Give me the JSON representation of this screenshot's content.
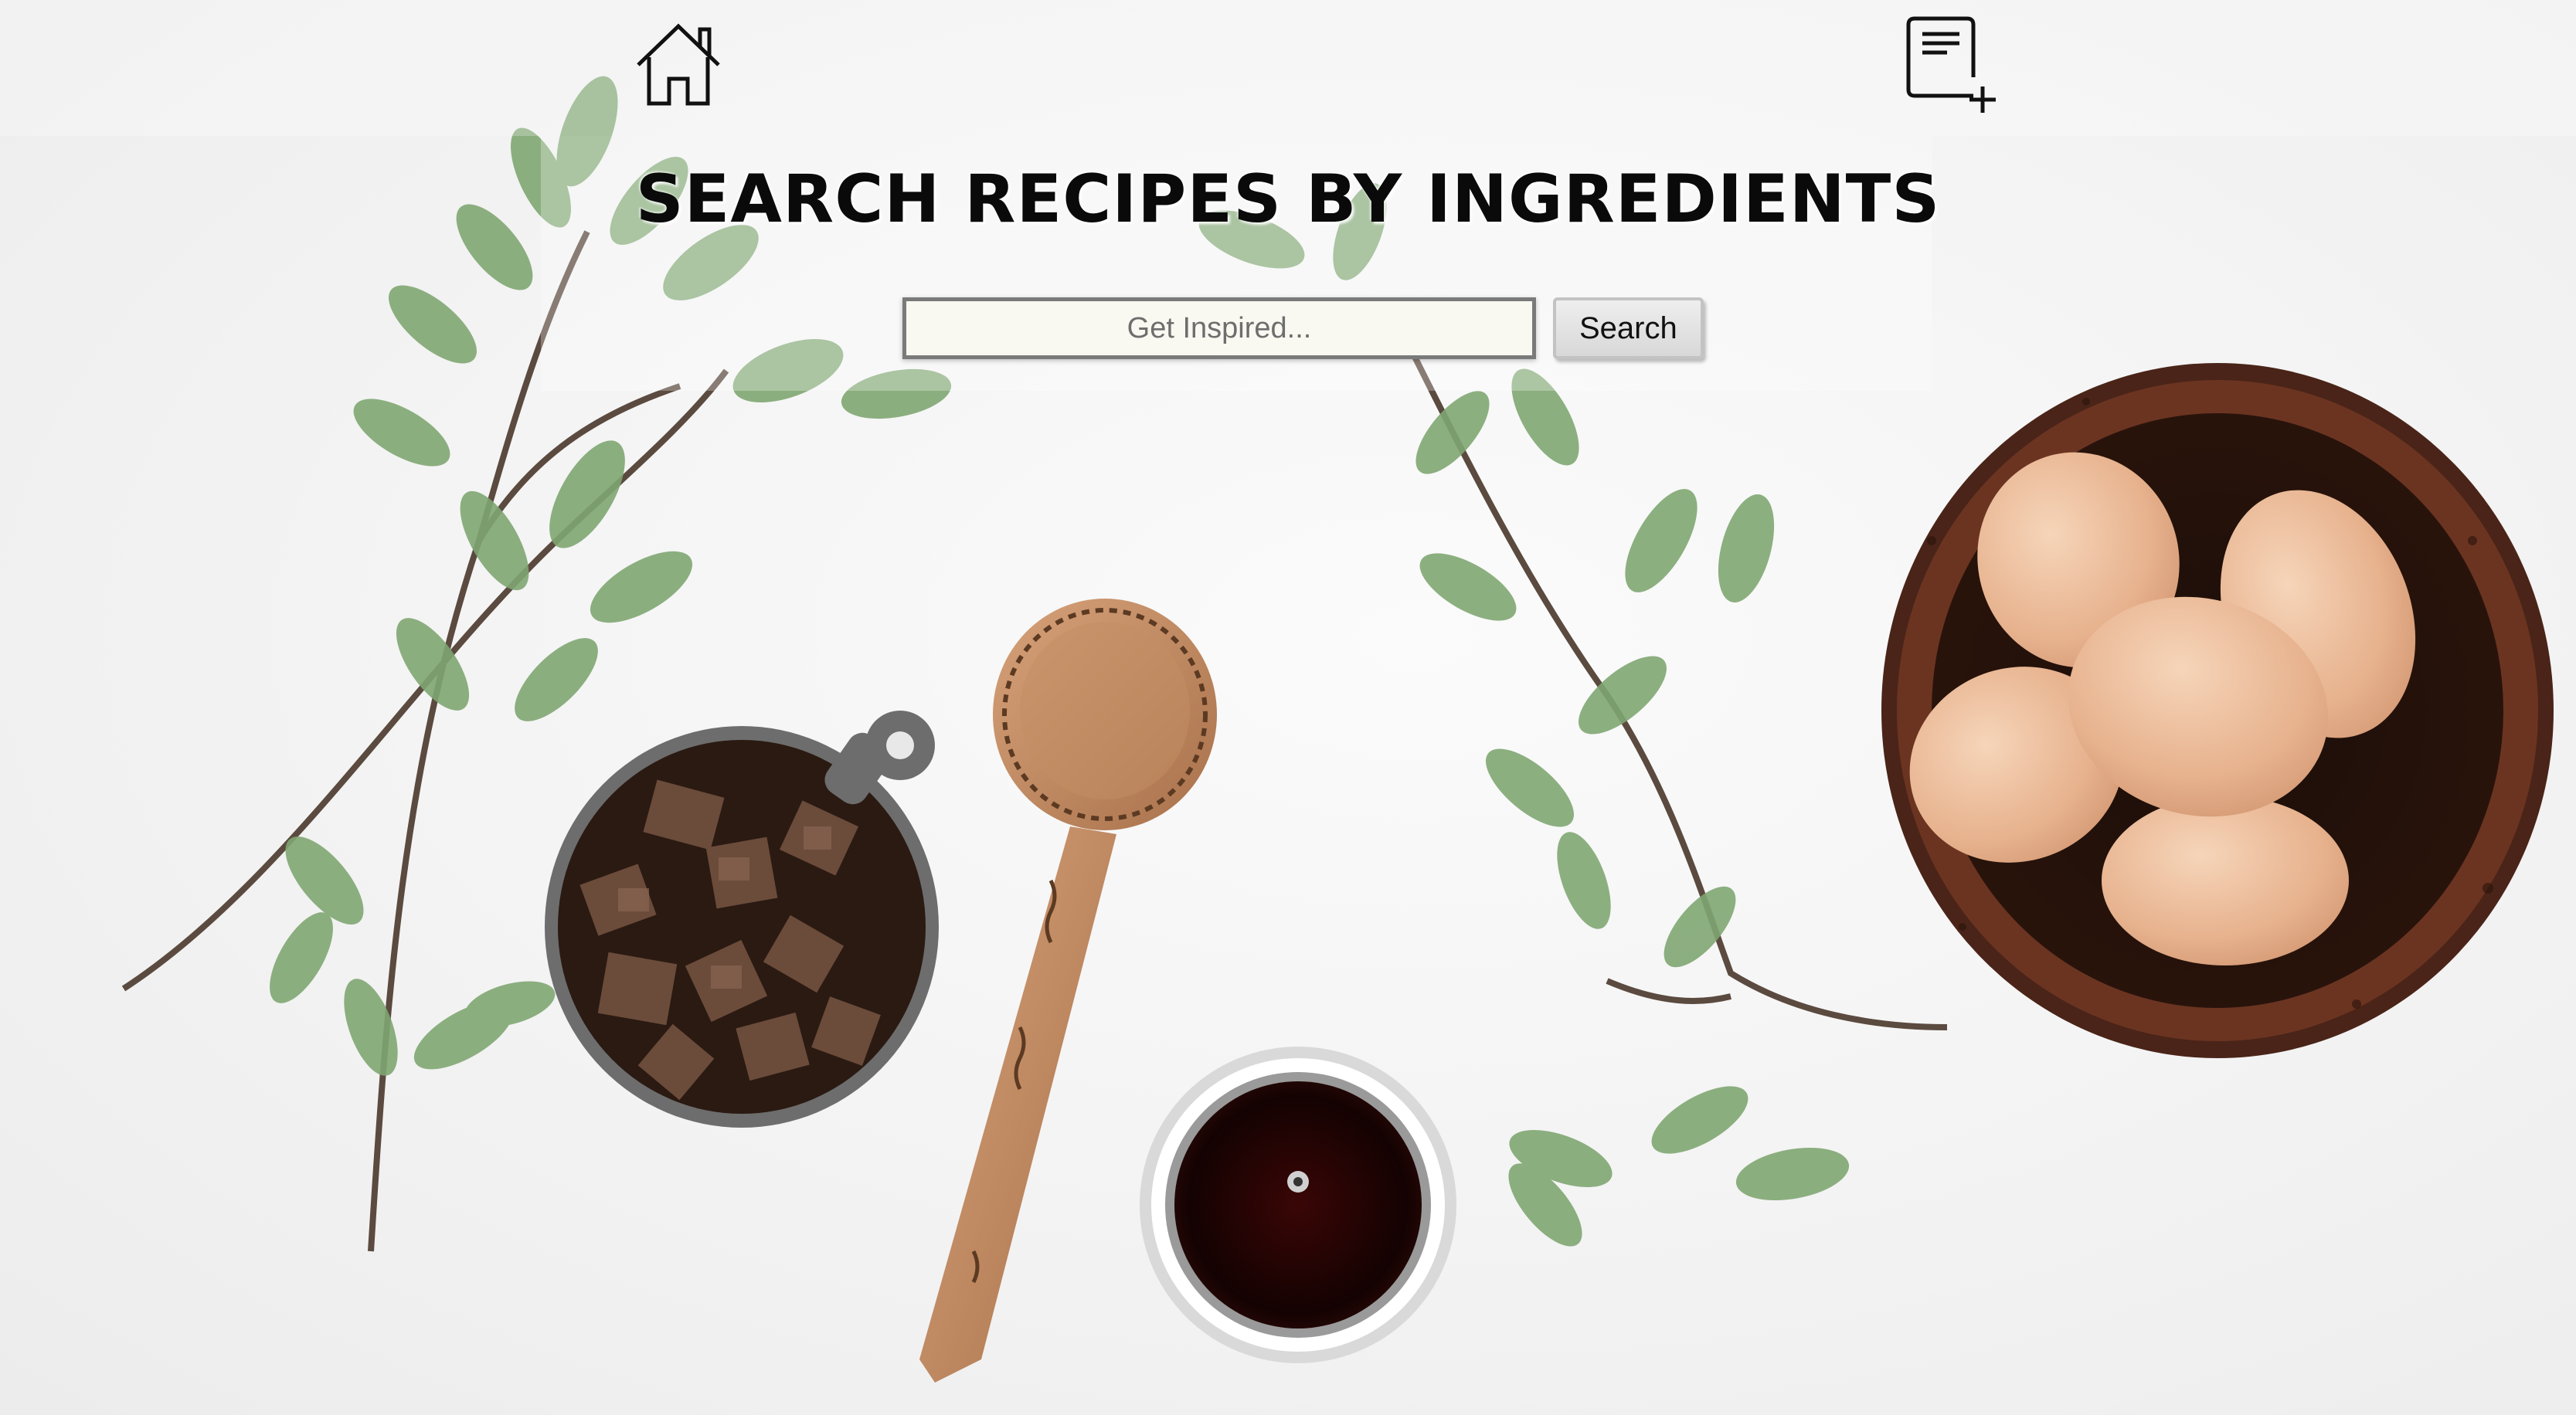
{
  "nav": {
    "home_icon": "home-icon",
    "add_recipe_icon": "document-plus-icon"
  },
  "hero": {
    "title": "SEARCH RECIPES BY INGREDIENTS"
  },
  "search": {
    "placeholder": "Get Inspired...",
    "value": "",
    "button_label": "Search"
  },
  "colors": {
    "title": "#0a0a0a",
    "input_background": "#f9f9f1",
    "input_border": "#7a7a7a",
    "button_background": "#e0e0e0"
  }
}
